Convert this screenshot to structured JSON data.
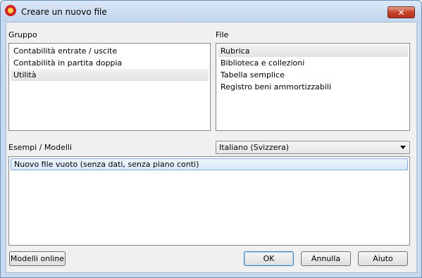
{
  "window": {
    "title": "Creare un nuovo file",
    "close_glyph": "✕"
  },
  "group": {
    "label": "Gruppo",
    "items": [
      {
        "label": "Contabilità entrate / uscite"
      },
      {
        "label": "Contabilità in partita doppia"
      },
      {
        "label": "Utilità"
      }
    ],
    "selected_index": 2
  },
  "file": {
    "label": "File",
    "items": [
      {
        "label": "Rubrica"
      },
      {
        "label": "Biblioteca e collezioni"
      },
      {
        "label": "Tabella semplice"
      },
      {
        "label": "Registro beni ammortizzabili"
      }
    ],
    "selected_index": 0
  },
  "templates": {
    "label": "Esempi / Modelli",
    "language": "Italiano (Svizzera)",
    "items": [
      {
        "label": "Nuovo file vuoto (senza dati, senza piano conti)"
      }
    ],
    "selected_index": 0
  },
  "buttons": {
    "online": "Modelli online",
    "ok": "OK",
    "cancel": "Annulla",
    "help": "Aiuto"
  }
}
